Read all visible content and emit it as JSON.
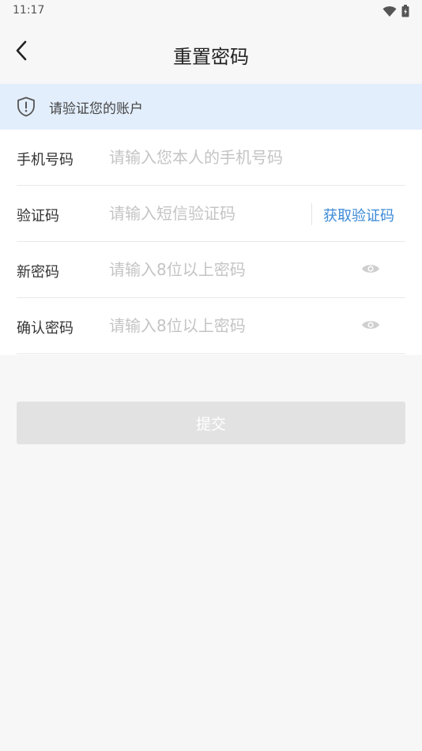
{
  "status_bar": {
    "time": "11:17",
    "icons": [
      "wifi-icon",
      "battery-icon"
    ]
  },
  "nav": {
    "title": "重置密码",
    "back_icon": "chevron-left-icon"
  },
  "notice": {
    "icon": "shield-alert-icon",
    "text": "请验证您的账户"
  },
  "form": {
    "phone": {
      "label": "手机号码",
      "placeholder": "请输入您本人的手机号码",
      "value": ""
    },
    "code": {
      "label": "验证码",
      "placeholder": "请输入短信验证码",
      "value": "",
      "button_label": "获取验证码"
    },
    "new_password": {
      "label": "新密码",
      "placeholder": "请输入8位以上密码",
      "value": "",
      "toggle_icon": "eye-icon"
    },
    "confirm_password": {
      "label": "确认密码",
      "placeholder": "请输入8位以上密码",
      "value": "",
      "toggle_icon": "eye-icon"
    }
  },
  "submit": {
    "label": "提交"
  },
  "colors": {
    "page_background": "#f7f7f7",
    "notice_background": "#e3eefc",
    "link_blue": "#3b8ad6",
    "placeholder": "#c4c4c4",
    "button_disabled": "#e2e2e2"
  }
}
